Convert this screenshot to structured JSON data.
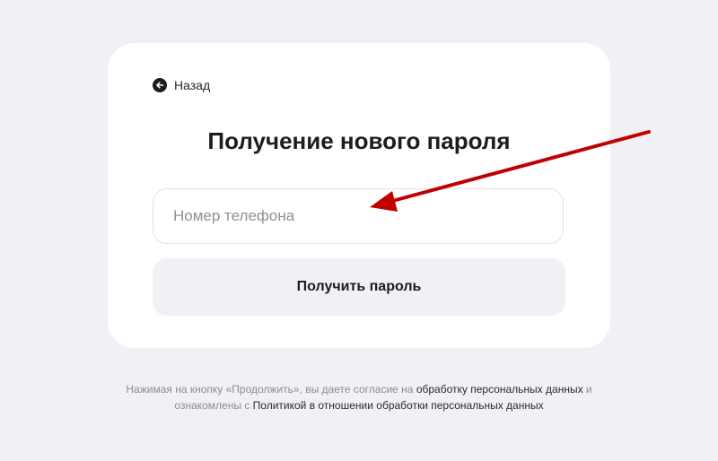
{
  "back": {
    "label": "Назад",
    "icon": "arrow-left-circle-icon"
  },
  "title": "Получение нового пароля",
  "phone_input": {
    "value": "",
    "placeholder": "Номер телефона"
  },
  "submit_label": "Получить пароль",
  "consent": {
    "line1_prefix": "Нажимая на кнопку «Продолжить», вы даете согласие на ",
    "line1_link": "обработку персональных данных",
    "line1_suffix": " и",
    "line2_prefix": "ознакомлены с ",
    "line2_link": "Политикой в отношении обработки персональных данных"
  },
  "colors": {
    "background": "#f1f0f5",
    "card": "#ffffff",
    "annotation_arrow": "#c00000"
  }
}
